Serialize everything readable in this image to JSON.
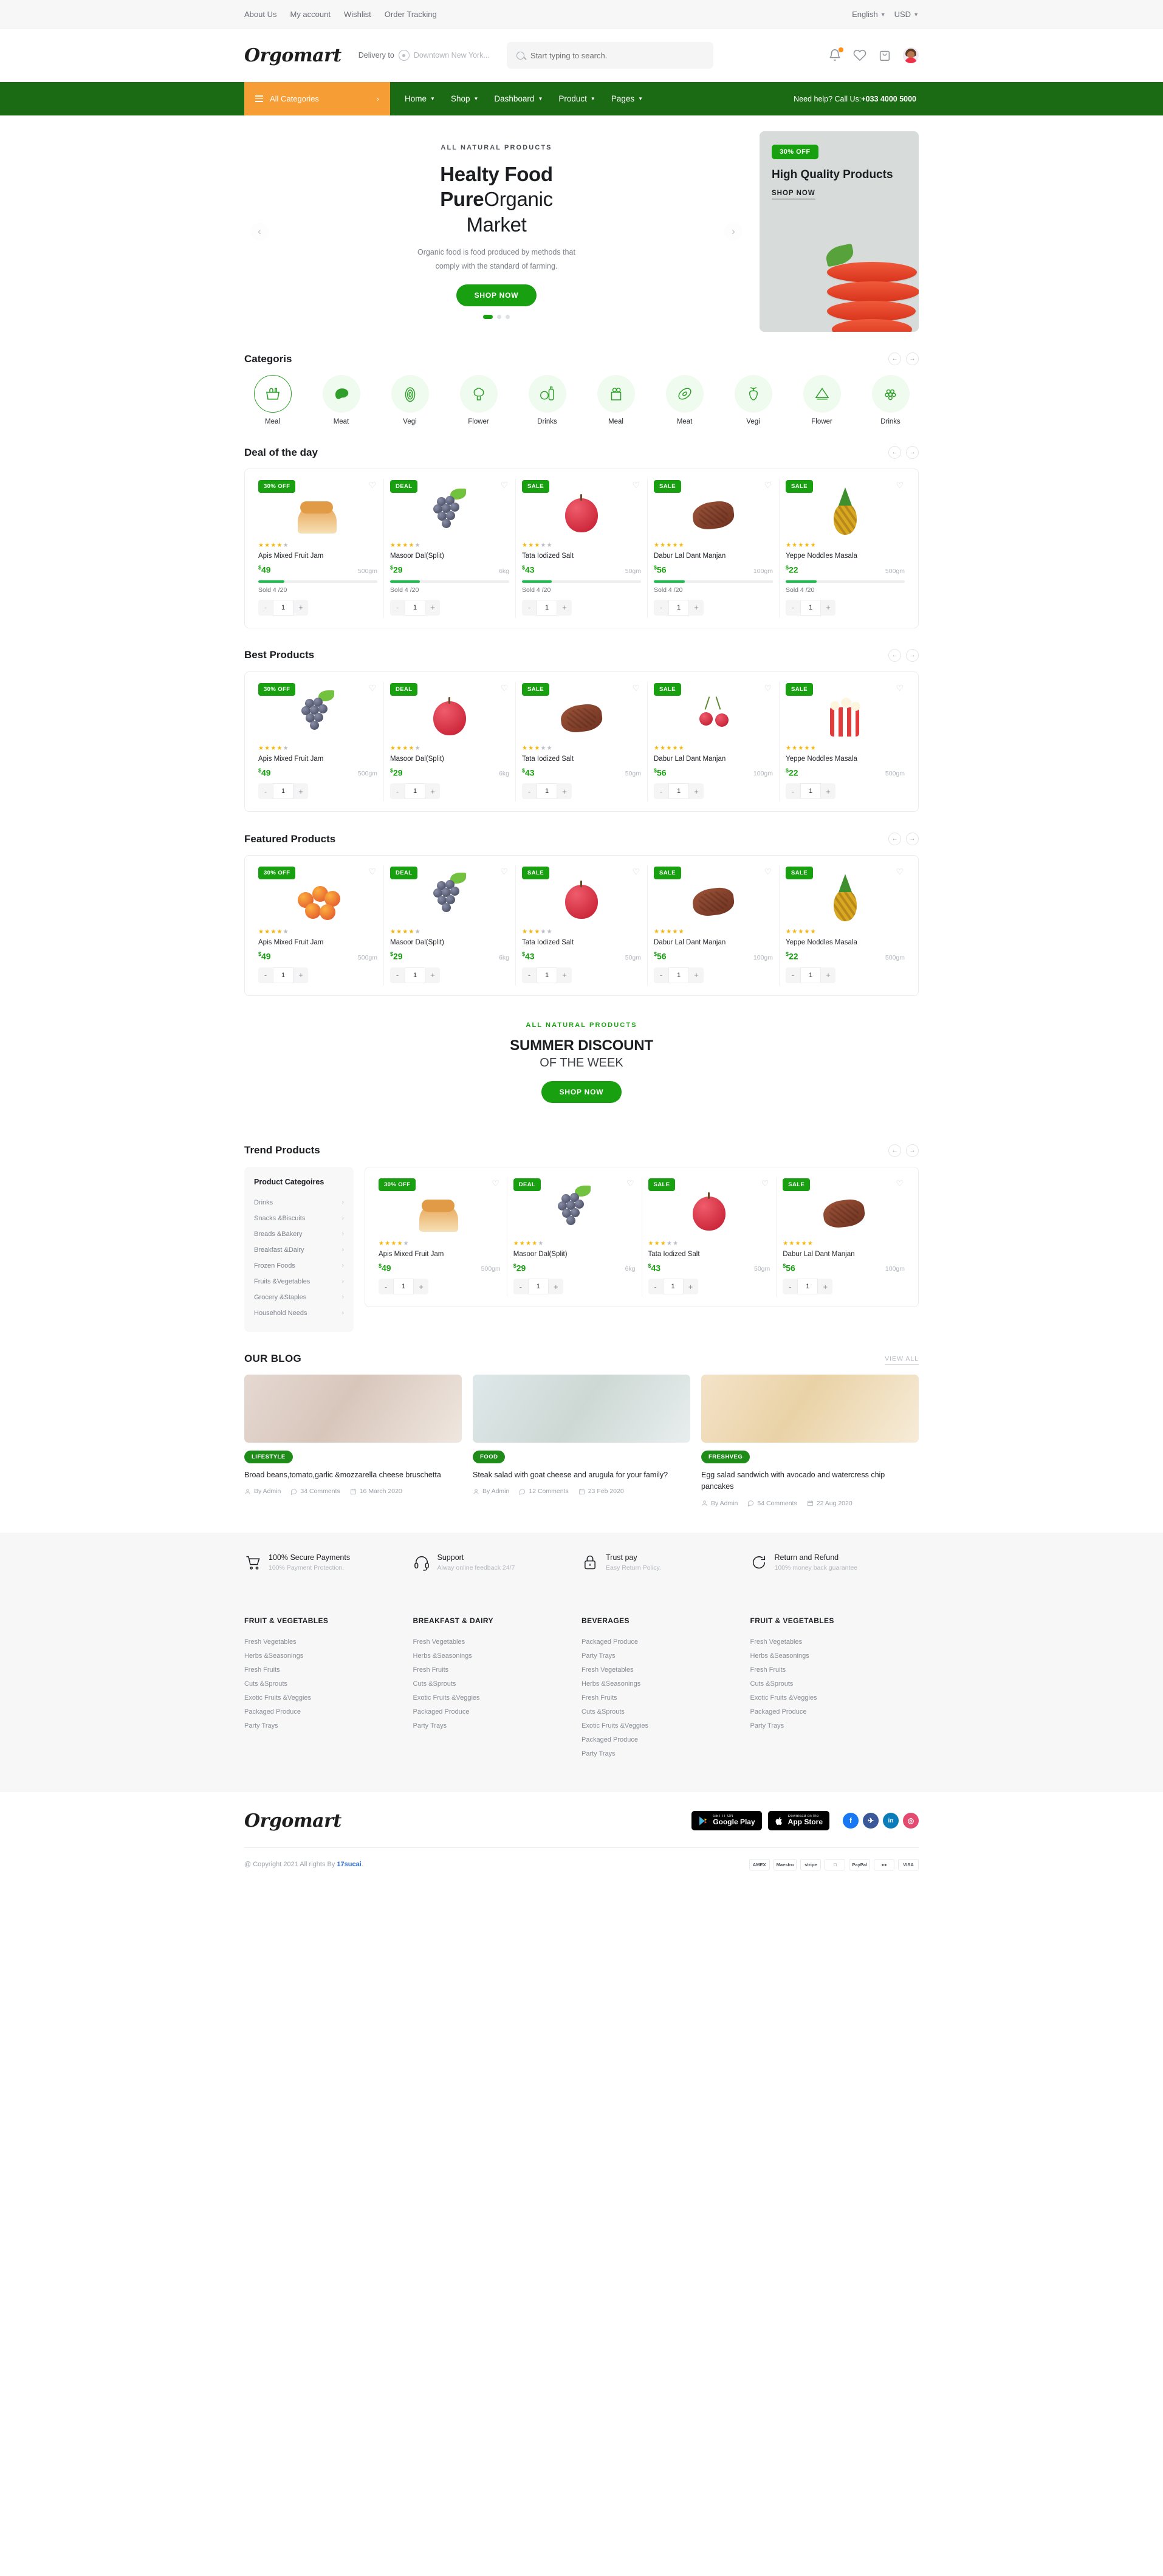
{
  "topbar": {
    "links": [
      "About Us",
      "My account",
      "Wishlist",
      "Order Tracking"
    ],
    "language": "English",
    "currency": "USD"
  },
  "header": {
    "logo": "Orgomart",
    "delivery_label": "Delivery to",
    "delivery_location": "Downtown New York...",
    "search_placeholder": "Start typing to search.",
    "search_value": ""
  },
  "nav": {
    "all_categories": "All Categories",
    "links": [
      "Home",
      "Shop",
      "Dashboard",
      "Product",
      "Pages"
    ],
    "help_text": "Need help? Call Us:",
    "help_phone": "+033 4000 5000"
  },
  "hero": {
    "eyebrow": "ALL NATURAL PRODUCTS",
    "title_line1": "Healty Food",
    "title_bold": "Pure",
    "title_thin": "Organic",
    "title_line3": "Market",
    "description": "Organic food is food produced by methods that comply with the standard of farming.",
    "cta": "SHOP NOW"
  },
  "promo": {
    "badge": "30% OFF",
    "title": "High Quality Products",
    "cta": "SHOP NOW"
  },
  "categories_section": {
    "title": "Categoris",
    "items": [
      {
        "label": "Meal",
        "icon": "basket-icon"
      },
      {
        "label": "Meat",
        "icon": "meat-icon"
      },
      {
        "label": "Vegi",
        "icon": "onion-icon"
      },
      {
        "label": "Flower",
        "icon": "broccoli-icon"
      },
      {
        "label": "Drinks",
        "icon": "bottle-icon"
      },
      {
        "label": "Meal",
        "icon": "grocery-bag-icon"
      },
      {
        "label": "Meat",
        "icon": "avocado-icon"
      },
      {
        "label": "Vegi",
        "icon": "beet-icon"
      },
      {
        "label": "Flower",
        "icon": "watermelon-icon"
      },
      {
        "label": "Drinks",
        "icon": "grapes-icon"
      }
    ]
  },
  "deal_section": {
    "title": "Deal of the day",
    "products": [
      {
        "badge": "30% OFF",
        "name": "Apis Mixed Fruit Jam",
        "price": "49",
        "weight": "500gm",
        "stars": 4,
        "sold": "Sold 4 /20",
        "progress": 22,
        "qty": "1",
        "img": "bread"
      },
      {
        "badge": "DEAL",
        "name": "Masoor Dal(Split)",
        "price": "29",
        "weight": "6kg",
        "stars": 4,
        "sold": "Sold 4 /20",
        "progress": 25,
        "qty": "1",
        "img": "grapes"
      },
      {
        "badge": "SALE",
        "name": "Tata Iodized Salt",
        "price": "43",
        "weight": "50gm",
        "stars": 3,
        "sold": "Sold 4 /20",
        "progress": 25,
        "qty": "1",
        "img": "apple"
      },
      {
        "badge": "SALE",
        "name": "Dabur Lal Dant Manjan",
        "price": "56",
        "weight": "100gm",
        "stars": 5,
        "sold": "Sold 4 /20",
        "progress": 26,
        "qty": "1",
        "img": "steak"
      },
      {
        "badge": "SALE",
        "name": "Yeppe Noddles Masala",
        "price": "22",
        "weight": "500gm",
        "stars": 5,
        "sold": "Sold 4 /20",
        "progress": 26,
        "qty": "1",
        "img": "pineapple"
      }
    ]
  },
  "best_section": {
    "title": "Best Products",
    "products": [
      {
        "badge": "30% OFF",
        "name": "Apis Mixed Fruit Jam",
        "price": "49",
        "weight": "500gm",
        "stars": 4,
        "qty": "1",
        "img": "grapes"
      },
      {
        "badge": "DEAL",
        "name": "Masoor Dal(Split)",
        "price": "29",
        "weight": "6kg",
        "stars": 4,
        "qty": "1",
        "img": "apple"
      },
      {
        "badge": "SALE",
        "name": "Tata Iodized Salt",
        "price": "43",
        "weight": "50gm",
        "stars": 3,
        "qty": "1",
        "img": "steak"
      },
      {
        "badge": "SALE",
        "name": "Dabur Lal Dant Manjan",
        "price": "56",
        "weight": "100gm",
        "stars": 5,
        "qty": "1",
        "img": "cherry"
      },
      {
        "badge": "SALE",
        "name": "Yeppe Noddles Masala",
        "price": "22",
        "weight": "500gm",
        "stars": 5,
        "qty": "1",
        "img": "popcorn"
      }
    ]
  },
  "featured_section": {
    "title": "Featured Products",
    "products": [
      {
        "badge": "30% OFF",
        "name": "Apis Mixed Fruit Jam",
        "price": "49",
        "weight": "500gm",
        "stars": 4,
        "qty": "1",
        "img": "peach"
      },
      {
        "badge": "DEAL",
        "name": "Masoor Dal(Split)",
        "price": "29",
        "weight": "6kg",
        "stars": 4,
        "qty": "1",
        "img": "grapes"
      },
      {
        "badge": "SALE",
        "name": "Tata Iodized Salt",
        "price": "43",
        "weight": "50gm",
        "stars": 3,
        "qty": "1",
        "img": "apple"
      },
      {
        "badge": "SALE",
        "name": "Dabur Lal Dant Manjan",
        "price": "56",
        "weight": "100gm",
        "stars": 5,
        "qty": "1",
        "img": "steak"
      },
      {
        "badge": "SALE",
        "name": "Yeppe Noddles Masala",
        "price": "22",
        "weight": "500gm",
        "stars": 5,
        "qty": "1",
        "img": "pineapple"
      }
    ]
  },
  "summer": {
    "eyebrow": "ALL NATURAL PRODUCTS",
    "title": "SUMMER DISCOUNT",
    "subtitle": "OF THE WEEK",
    "cta": "SHOP NOW"
  },
  "trend_section": {
    "title": "Trend Products",
    "sidebar_title": "Product Categoires",
    "sidebar_items": [
      "Drinks",
      "Snacks &Biscuits",
      "Breads &Bakery",
      "Breakfast &Dairy",
      "Frozen Foods",
      "Fruits &Vegetables",
      "Grocery &Staples",
      "Household Needs"
    ],
    "products": [
      {
        "badge": "30% OFF",
        "name": "Apis Mixed Fruit Jam",
        "price": "49",
        "weight": "500gm",
        "stars": 4,
        "qty": "1",
        "img": "bread"
      },
      {
        "badge": "DEAL",
        "name": "Masoor Dal(Split)",
        "price": "29",
        "weight": "6kg",
        "stars": 4,
        "qty": "1",
        "img": "grapes"
      },
      {
        "badge": "SALE",
        "name": "Tata Iodized Salt",
        "price": "43",
        "weight": "50gm",
        "stars": 3,
        "qty": "1",
        "img": "apple"
      },
      {
        "badge": "SALE",
        "name": "Dabur Lal Dant Manjan",
        "price": "56",
        "weight": "100gm",
        "stars": 5,
        "qty": "1",
        "img": "steak"
      }
    ]
  },
  "blog_section": {
    "title": "OUR BLOG",
    "view_all": "VIEW ALL",
    "posts": [
      {
        "tag": "LIFESTYLE",
        "title": "Broad beans,tomato,garlic &mozzarella cheese bruschetta",
        "author": "By Admin",
        "comments": "34 Comments",
        "date": "16 March 2020"
      },
      {
        "tag": "FOOD",
        "title": "Steak salad with goat cheese and arugula for your family?",
        "author": "By Admin",
        "comments": "12 Comments",
        "date": "23 Feb 2020"
      },
      {
        "tag": "FRESHVEG",
        "title": "Egg salad sandwich with avocado and watercress chip pancakes",
        "author": "By Admin",
        "comments": "54 Comments",
        "date": "22 Aug 2020"
      }
    ]
  },
  "features": [
    {
      "icon": "cart-icon",
      "title": "100% Secure Payments",
      "sub": "100% Payment Protection."
    },
    {
      "icon": "headset-icon",
      "title": "Support",
      "sub": "Alway online feedback 24/7"
    },
    {
      "icon": "lock-icon",
      "title": "Trust pay",
      "sub": "Easy Return Policy."
    },
    {
      "icon": "return-icon",
      "title": "Return and Refund",
      "sub": "100% money back guarantee"
    }
  ],
  "footer_columns": [
    {
      "title": "FRUIT & VEGETABLES",
      "links": [
        "Fresh Vegetables",
        "Herbs &Seasonings",
        "Fresh Fruits",
        "Cuts &Sprouts",
        "Exotic Fruits &Veggies",
        "Packaged Produce",
        "Party Trays"
      ]
    },
    {
      "title": "BREAKFAST & DAIRY",
      "links": [
        "Fresh Vegetables",
        "Herbs &Seasonings",
        "Fresh Fruits",
        "Cuts &Sprouts",
        "Exotic Fruits &Veggies",
        "Packaged Produce",
        "Party Trays"
      ]
    },
    {
      "title": "BEVERAGES",
      "links": [
        "Packaged Produce",
        "Party Trays",
        "Fresh Vegetables",
        "Herbs &Seasonings",
        "Fresh Fruits",
        "Cuts &Sprouts",
        "Exotic Fruits &Veggies",
        "Packaged Produce",
        "Party Trays"
      ]
    },
    {
      "title": "FRUIT & VEGETABLES",
      "links": [
        "Fresh Vegetables",
        "Herbs &Seasonings",
        "Fresh Fruits",
        "Cuts &Sprouts",
        "Exotic Fruits &Veggies",
        "Packaged Produce",
        "Party Trays"
      ]
    }
  ],
  "footer_bottom": {
    "logo": "Orgomart",
    "google_play_small": "GET IT ON",
    "google_play_big": "Google Play",
    "app_store_small": "Download on the",
    "app_store_big": "App Store",
    "socials": [
      {
        "name": "facebook-icon",
        "glyph": "f",
        "color": "#1877f2"
      },
      {
        "name": "twitter-icon",
        "glyph": "t",
        "color": "#3b5998"
      },
      {
        "name": "linkedin-icon",
        "glyph": "in",
        "color": "#0a7cb9"
      },
      {
        "name": "instagram-icon",
        "glyph": "◎",
        "color": "#e34a6f"
      }
    ],
    "copyright_prefix": "@ Copyright 2021 All rights By ",
    "copyright_link": "17sucai",
    "copyright_suffix": ".",
    "payments": [
      "AMEX",
      "Maestro",
      "stripe",
      "□",
      "PayPal",
      "●●",
      "VISA"
    ]
  },
  "colors": {
    "brand_green": "#18a011",
    "nav_green": "#1a6b14",
    "accent_orange": "#f79d35",
    "star": "#f5b50a"
  }
}
